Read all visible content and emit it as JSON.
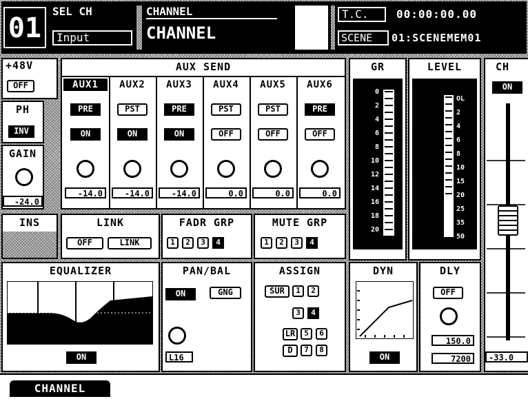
{
  "header": {
    "channel_number": "01",
    "sel_ch_label": "SEL CH",
    "sel_ch_value": "Input",
    "channel_label": "CHANNEL",
    "channel_name": "CHANNEL",
    "tc_label": "T.C.",
    "tc_value": "00:00:00.00",
    "scene_label": "SCENE",
    "scene_value": "01:SCENEMEM01"
  },
  "left": {
    "phantom_label": "+48V",
    "phantom_state": "OFF",
    "phase_label": "PH",
    "phase_state": "INV",
    "gain_label": "GAIN",
    "gain_value": "-24.0"
  },
  "aux_send": {
    "title": "AUX SEND",
    "channels": [
      {
        "name": "AUX1",
        "mode": "PRE",
        "state": "ON",
        "value": "-14.0",
        "selected": true
      },
      {
        "name": "AUX2",
        "mode": "PST",
        "state": "ON",
        "value": "-14.0",
        "selected": false
      },
      {
        "name": "AUX3",
        "mode": "PRE",
        "state": "ON",
        "value": "-14.0",
        "selected": false
      },
      {
        "name": "AUX4",
        "mode": "PST",
        "state": "OFF",
        "value": "0.0",
        "selected": false
      },
      {
        "name": "AUX5",
        "mode": "PST",
        "state": "OFF",
        "value": "0.0",
        "selected": false
      },
      {
        "name": "AUX6",
        "mode": "PRE",
        "state": "OFF",
        "value": "0.0",
        "selected": false
      }
    ]
  },
  "gr_meter": {
    "title": "GR",
    "scale": [
      "0",
      "2",
      "4",
      "6",
      "8",
      "10",
      "12",
      "14",
      "16",
      "18",
      "20"
    ]
  },
  "level_meter": {
    "title": "LEVEL",
    "scale": [
      "OL",
      "2",
      "4",
      "6",
      "8",
      "10",
      "15",
      "20",
      "25",
      "35",
      "50"
    ],
    "lit_segments": 6
  },
  "ch_fader": {
    "title": "CH",
    "state": "ON",
    "value": "-33.0"
  },
  "ins": {
    "title": "INS"
  },
  "link": {
    "title": "LINK",
    "off_label": "OFF",
    "link_label": "LINK"
  },
  "fadr_grp": {
    "title": "FADR GRP",
    "buttons": [
      "1",
      "2",
      "3",
      "4"
    ]
  },
  "mute_grp": {
    "title": "MUTE GRP",
    "buttons": [
      "1",
      "2",
      "3",
      "4"
    ]
  },
  "equalizer": {
    "title": "EQUALIZER",
    "state": "ON"
  },
  "pan_bal": {
    "title": "PAN/BAL",
    "state": "ON",
    "gang_label": "GNG",
    "value": "L16"
  },
  "assign": {
    "title": "ASSIGN",
    "sur_label": "SUR",
    "lr_label": "LR",
    "direct_label": "D",
    "buttons": [
      "1",
      "2",
      "3",
      "4",
      "5",
      "6",
      "7",
      "8"
    ]
  },
  "dyn": {
    "title": "DYN",
    "state": "ON"
  },
  "dly": {
    "title": "DLY",
    "state": "OFF",
    "time_value": "150.0",
    "sample_value": "7200"
  },
  "bottom_tab": {
    "label": "CHANNEL"
  },
  "colors": {
    "foreground": "#000000",
    "background": "#ffffff",
    "hatch": "#7a7a7a"
  }
}
